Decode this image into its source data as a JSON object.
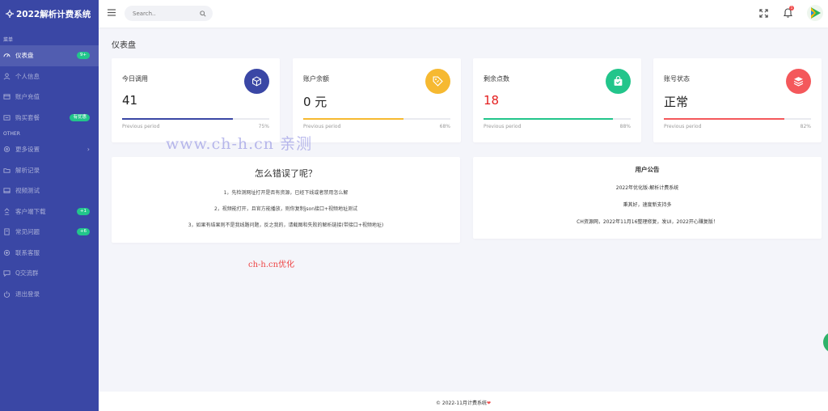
{
  "brand": {
    "title": "2022解析计费系统"
  },
  "sidebar": {
    "section_main": "菜单",
    "section_other": "OTHER",
    "items": [
      {
        "label": "仪表盘",
        "badge": "9+",
        "icon": "speedometer-icon"
      },
      {
        "label": "个人信息",
        "icon": "user-icon"
      },
      {
        "label": "账户充值",
        "icon": "card-icon"
      },
      {
        "label": "购买套餐",
        "badge": "有优惠",
        "icon": "cart-icon"
      },
      {
        "label": "更多设置",
        "icon": "gear-icon",
        "chevron": "›"
      },
      {
        "label": "解析记录",
        "icon": "folder-icon"
      },
      {
        "label": "视频测试",
        "icon": "video-icon"
      },
      {
        "label": "客户端下载",
        "badge": "+1",
        "icon": "download-icon"
      },
      {
        "label": "常见问题",
        "badge": "+6",
        "icon": "question-icon"
      },
      {
        "label": "联系客服",
        "icon": "support-icon"
      },
      {
        "label": "Q交流群",
        "icon": "chat-icon"
      },
      {
        "label": "退出登录",
        "icon": "power-icon"
      }
    ]
  },
  "topbar": {
    "search_placeholder": "Search..",
    "notify_count": "1"
  },
  "page_title": "仪表盘",
  "stats": [
    {
      "label": "今日调用",
      "value": "41",
      "period": "Previous period",
      "percent": "75%",
      "fill": 0.75,
      "color": "#3a47a5",
      "icon": "cube-icon"
    },
    {
      "label": "账户余额",
      "value": "0 元",
      "period": "Previous period",
      "percent": "68%",
      "fill": 0.68,
      "color": "#f6b931",
      "icon": "price-tag-icon"
    },
    {
      "label": "剩余点数",
      "value": "18",
      "period": "Previous period",
      "percent": "88%",
      "fill": 0.88,
      "color": "#22c58b",
      "icon": "shopping-bag-icon"
    },
    {
      "label": "账号状态",
      "value": "正常",
      "period": "Previous period",
      "percent": "82%",
      "fill": 0.82,
      "color": "#f4585b",
      "icon": "layers-icon"
    }
  ],
  "error_help": {
    "title": "怎么错误了呢？",
    "lines": [
      "1，先检测网址打开是否有资源，已经下线或者禁用怎么解",
      "2，视频能打开，且官方能播放，则你复制json接口+视频地址测试",
      "3，如果有结果则不是我线路问题，反之我的，请截图和失败的解析链接(带接口+视频地址)"
    ]
  },
  "notice": {
    "title": "用户公告",
    "lines": [
      "2022年优化版-解析计费系统",
      "秉其好，速度新支持多",
      "CH资源网，2022年11月16整理修复，发UI，2022开心赚复版！"
    ]
  },
  "watermark": {
    "main": "www.ch-h.cn  亲测",
    "sub": "ch-h.cn优化"
  },
  "footer": {
    "text": "© 2022-11月计费系统",
    "heart": "❤"
  },
  "colors": {
    "sidebar": "#3a47a5",
    "accent_green": "#22c58b"
  }
}
